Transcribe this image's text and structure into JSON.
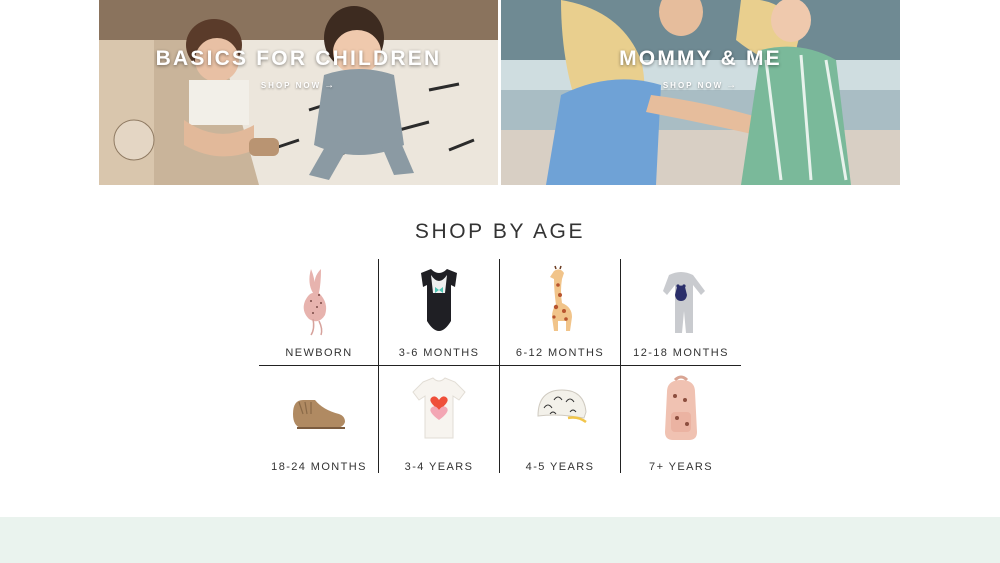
{
  "banners": [
    {
      "title": "BASICS FOR CHILDREN",
      "cta": "SHOP NOW"
    },
    {
      "title": "MOMMY & ME",
      "cta": "SHOP NOW"
    }
  ],
  "cta_arrow": "→",
  "shop_by_age": {
    "title": "SHOP BY AGE",
    "items": [
      {
        "label": "NEWBORN",
        "icon": "bunny-rattle-icon"
      },
      {
        "label": "3-6 MONTHS",
        "icon": "tuxedo-onesie-icon"
      },
      {
        "label": "6-12 MONTHS",
        "icon": "giraffe-toy-icon"
      },
      {
        "label": "12-18 MONTHS",
        "icon": "bear-sleeper-icon"
      },
      {
        "label": "18-24 MONTHS",
        "icon": "moccasin-shoe-icon"
      },
      {
        "label": "3-4 YEARS",
        "icon": "heart-tshirt-icon"
      },
      {
        "label": "4-5 YEARS",
        "icon": "printed-cap-icon"
      },
      {
        "label": "7+ YEARS",
        "icon": "backpack-icon"
      }
    ]
  },
  "colors": {
    "footer_band": "#eaf3ee",
    "grid_lines": "#222222",
    "text": "#333333"
  }
}
